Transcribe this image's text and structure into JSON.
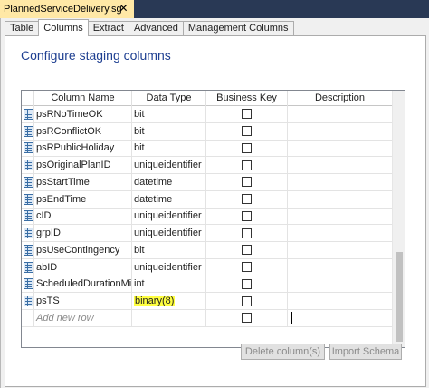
{
  "document_tab": {
    "title": "PlannedServiceDelivery.sg",
    "close_glyph": "✕"
  },
  "tabs": [
    {
      "label": "Table",
      "active": false
    },
    {
      "label": "Columns",
      "active": true
    },
    {
      "label": "Extract",
      "active": false
    },
    {
      "label": "Advanced",
      "active": false
    },
    {
      "label": "Management Columns",
      "active": false
    }
  ],
  "heading": "Configure staging columns",
  "grid": {
    "headers": [
      "Column Name",
      "Data Type",
      "Business Key",
      "Description"
    ],
    "rows": [
      {
        "name": "psRNoTimeOK",
        "type": "bit",
        "business_key": false,
        "description": ""
      },
      {
        "name": "psRConflictOK",
        "type": "bit",
        "business_key": false,
        "description": ""
      },
      {
        "name": "psRPublicHoliday",
        "type": "bit",
        "business_key": false,
        "description": ""
      },
      {
        "name": "psOriginalPlanID",
        "type": "uniqueidentifier",
        "business_key": false,
        "description": ""
      },
      {
        "name": "psStartTime",
        "type": "datetime",
        "business_key": false,
        "description": ""
      },
      {
        "name": "psEndTime",
        "type": "datetime",
        "business_key": false,
        "description": ""
      },
      {
        "name": "cID",
        "type": "uniqueidentifier",
        "business_key": false,
        "description": ""
      },
      {
        "name": "grpID",
        "type": "uniqueidentifier",
        "business_key": false,
        "description": ""
      },
      {
        "name": "psUseContingency",
        "type": "bit",
        "business_key": false,
        "description": ""
      },
      {
        "name": "abID",
        "type": "uniqueidentifier",
        "business_key": false,
        "description": ""
      },
      {
        "name": "ScheduledDurationMins",
        "type": "int",
        "business_key": false,
        "description": ""
      },
      {
        "name": "psTS",
        "type": "binary(8)",
        "business_key": false,
        "description": "",
        "type_highlighted": true
      }
    ],
    "new_row_placeholder": "Add new row",
    "highlight_color": "#ffff40"
  },
  "buttons": {
    "delete": "Delete column(s)",
    "import": "Import Schema"
  },
  "colors": {
    "doc_tab_active": "#ffe8a6",
    "ide_background": "#293955",
    "heading": "#1e3f91"
  }
}
